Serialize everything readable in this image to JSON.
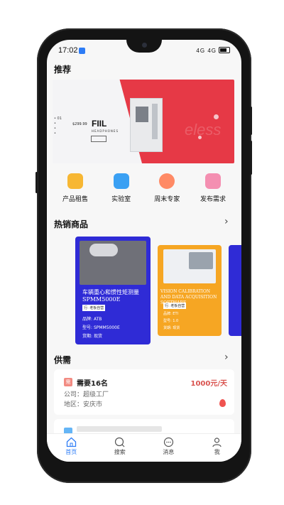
{
  "status_bar": {
    "time": "17:02",
    "indicators": "4G 4G"
  },
  "recommend": {
    "title": "推荐",
    "banner": {
      "price": "$299.99",
      "logo": "FIIL",
      "subtitle": "HEADPHONES",
      "ghost_text": "eless"
    }
  },
  "categories": [
    {
      "label": "产品租售",
      "icon": "product-rental-icon",
      "color": "#f7b733"
    },
    {
      "label": "实验室",
      "icon": "lab-icon",
      "color": "#3aa0f3"
    },
    {
      "label": "周末专家",
      "icon": "expert-icon",
      "color": "#ff8a65"
    },
    {
      "label": "发布需求",
      "icon": "publish-icon",
      "color": "#f48fb1"
    }
  ],
  "hot": {
    "title": "热销商品",
    "products": [
      {
        "title": "车辆重心和惯性矩测量 SPMM5000E",
        "tag": "行: 老板自营",
        "brand_label": "品牌: ",
        "brand": "ATB",
        "model_label": "型号: ",
        "model": "SPMM5000E",
        "stock_label": "货期: ",
        "stock": "现货",
        "color": "#2f2bd6"
      },
      {
        "title": "VISION CALIBRATION AND DATA ACQUISITION SOFTWARE",
        "tag": "行: 老板自营",
        "brand_label": "品牌: ",
        "brand": "ETI",
        "model_label": "型号: ",
        "model": "1.0",
        "stock_label": "货期: ",
        "stock": "现货",
        "color": "#f6a623"
      }
    ]
  },
  "supply": {
    "title": "供需",
    "items": [
      {
        "badge": "需",
        "title": "需要16名",
        "price": "1000元/天",
        "company_label": "公司：",
        "company": "超级工厂",
        "region_label": "地区：",
        "region": "安庆市"
      }
    ]
  },
  "tabbar": [
    {
      "label": "首页",
      "icon": "home-icon",
      "active": true
    },
    {
      "label": "搜索",
      "icon": "search-icon",
      "active": false
    },
    {
      "label": "消息",
      "icon": "message-icon",
      "active": false
    },
    {
      "label": "我",
      "icon": "user-icon",
      "active": false
    }
  ],
  "colors": {
    "accent": "#2d7cf6",
    "price": "#d9534f"
  }
}
